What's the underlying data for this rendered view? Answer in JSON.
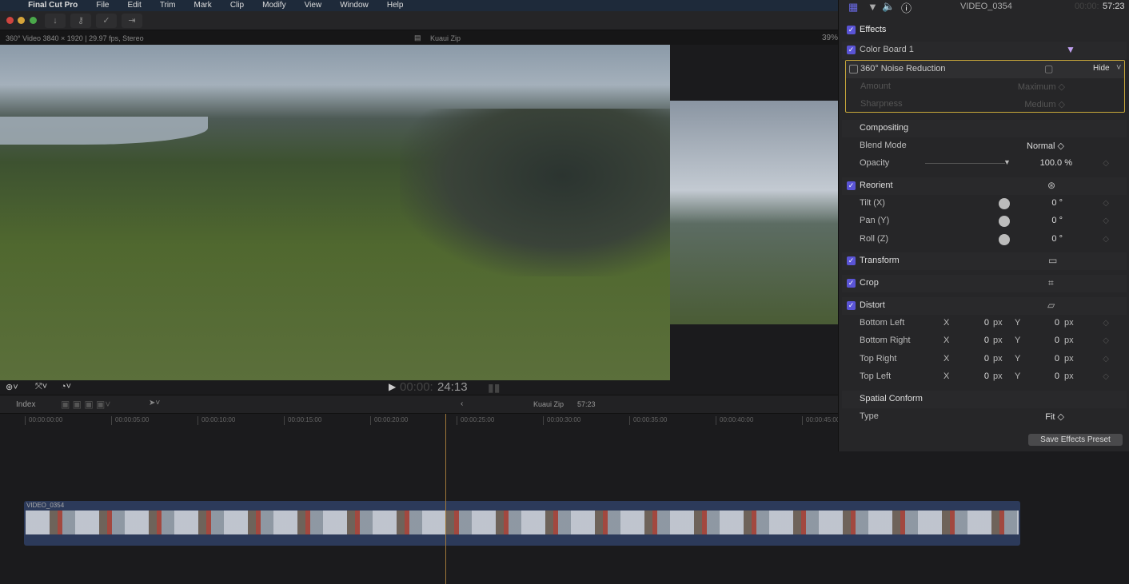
{
  "menu": [
    "Final Cut Pro",
    "File",
    "Edit",
    "Trim",
    "Mark",
    "Clip",
    "Modify",
    "View",
    "Window",
    "Help"
  ],
  "viewer": {
    "info": "360° Video 3840 × 1920 | 29.97 fps, Stereo",
    "project": "Kuaui Zip",
    "zoom": "39%",
    "timecode_dim": "00:00:",
    "timecode": "24:13"
  },
  "timeline": {
    "index": "Index",
    "project": "Kuaui Zip",
    "duration": "57:23",
    "ruler": [
      "00:00:00:00",
      "00:00:05:00",
      "00:00:10:00",
      "00:00:15:00",
      "00:00:20:00",
      "00:00:25:00",
      "00:00:30:00",
      "00:00:35:00",
      "00:00:40:00",
      "00:00:45:00"
    ],
    "clip_name": "VIDEO_0354"
  },
  "inspector": {
    "clip": "VIDEO_0354",
    "tc_dim": "00:00:",
    "tc": "57:23",
    "effects": "Effects",
    "color_board": "Color Board 1",
    "noise": "360° Noise Reduction",
    "hide": "Hide",
    "amount": "Amount",
    "amount_val": "Maximum ◇",
    "sharpness": "Sharpness",
    "sharpness_val": "Medium ◇",
    "compositing": "Compositing",
    "blend": "Blend Mode",
    "blend_val": "Normal ◇",
    "opacity": "Opacity",
    "opacity_val": "100.0 %",
    "opacity_level": 100,
    "reorient": "Reorient",
    "tilt": "Tilt (X)",
    "pan": "Pan (Y)",
    "roll": "Roll (Z)",
    "deg": "0 °",
    "transform": "Transform",
    "crop": "Crop",
    "distort": "Distort",
    "corners": [
      "Bottom Left",
      "Bottom Right",
      "Top Right",
      "Top Left"
    ],
    "x": "X",
    "y": "Y",
    "zero": "0",
    "px": "px",
    "spatial": "Spatial Conform",
    "type": "Type",
    "type_val": "Fit ◇",
    "save": "Save Effects Preset"
  },
  "colors": {
    "accent": "#5a54d6",
    "highlight": "#c9a83a"
  }
}
